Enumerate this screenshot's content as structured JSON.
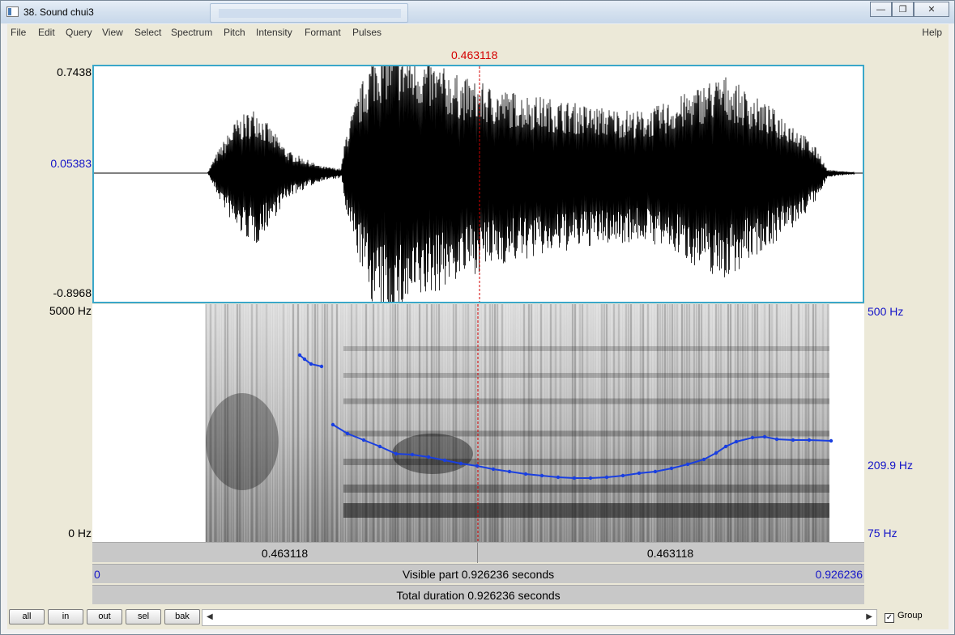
{
  "window": {
    "title": "38. Sound chui3",
    "minimize_icon": "minimize-icon",
    "maximize_icon": "restore-icon",
    "close_icon": "close-icon"
  },
  "menu": {
    "items": [
      "File",
      "Edit",
      "Query",
      "View",
      "Select",
      "Spectrum",
      "Pitch",
      "Intensity",
      "Formant",
      "Pulses"
    ],
    "help": "Help"
  },
  "cursor": {
    "time_label": "0.463118",
    "color": "#d40000"
  },
  "waveform": {
    "y_max": "0.7438",
    "y_cursor": "0.05383",
    "y_min": "-0.8968"
  },
  "spectrogram": {
    "freq_top": "5000 Hz",
    "freq_bottom": "0 Hz",
    "pitch_top": "500 Hz",
    "pitch_mid": "209.9 Hz",
    "pitch_bottom": "75 Hz",
    "pitch_color": "#1a3fe0"
  },
  "time_bars": {
    "left_half": "0.463118",
    "right_half": "0.463118",
    "visible_start": "0",
    "visible_end": "0.926236",
    "visible_part": "Visible part 0.926236 seconds",
    "total_duration": "Total duration 0.926236 seconds"
  },
  "controls": {
    "buttons": [
      "all",
      "in",
      "out",
      "sel",
      "bak"
    ],
    "scroll_left_icon": "chevron-left-icon",
    "scroll_right_icon": "chevron-right-icon",
    "group_label": "Group",
    "group_checked": true
  }
}
